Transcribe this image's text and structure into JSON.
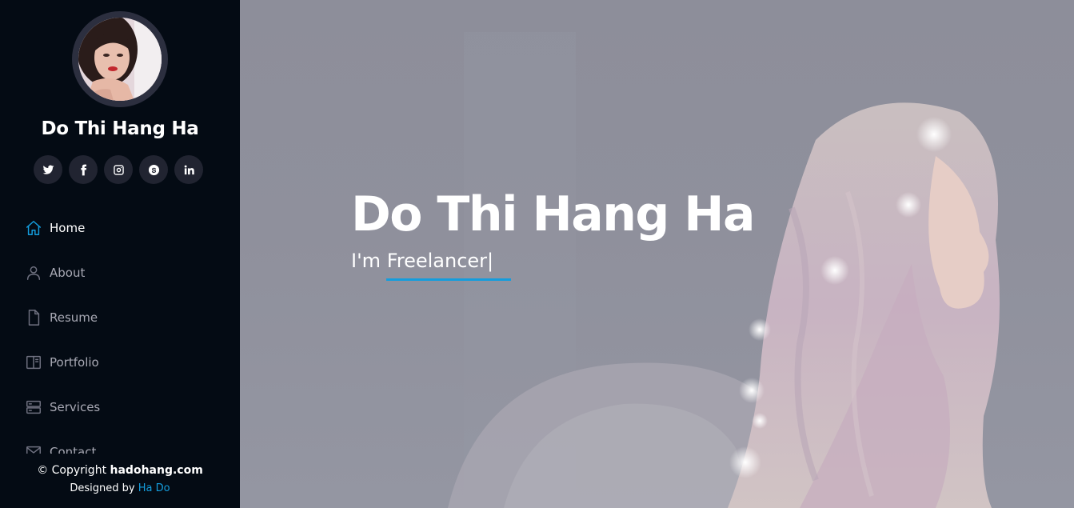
{
  "profile": {
    "name": "Do Thi Hang Ha"
  },
  "socials": [
    {
      "icon": "twitter-icon"
    },
    {
      "icon": "facebook-icon"
    },
    {
      "icon": "instagram-icon"
    },
    {
      "icon": "skype-icon"
    },
    {
      "icon": "linkedin-icon"
    }
  ],
  "nav": {
    "items": [
      {
        "label": "Home",
        "icon": "home-icon",
        "active": true
      },
      {
        "label": "About",
        "icon": "person-icon",
        "active": false
      },
      {
        "label": "Resume",
        "icon": "file-icon",
        "active": false
      },
      {
        "label": "Portfolio",
        "icon": "book-icon",
        "active": false
      },
      {
        "label": "Services",
        "icon": "server-icon",
        "active": false
      },
      {
        "label": "Contact",
        "icon": "envelope-icon",
        "active": false
      }
    ]
  },
  "footer": {
    "copyright_prefix": "© Copyright ",
    "copyright_site": "hadohang.com",
    "credits_prefix": "Designed by ",
    "credits_link": "Ha Do"
  },
  "hero": {
    "title": "Do Thi Hang Ha",
    "subtitle_prefix": "I'm ",
    "typed_text": "Freelancer",
    "cursor": "|"
  },
  "colors": {
    "accent": "#149ddd",
    "sidebar_bg": "#040b14",
    "social_bg": "#212431"
  }
}
